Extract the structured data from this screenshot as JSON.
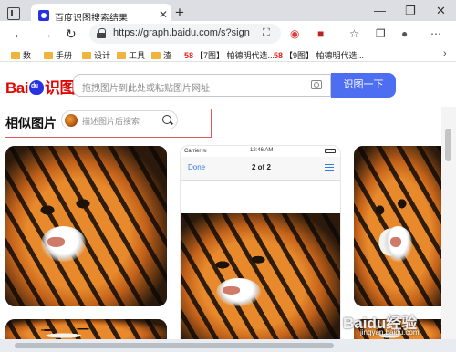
{
  "browser": {
    "tab_title": "百度识图搜索结果",
    "tab_close": "✕",
    "new_tab": "+",
    "window_controls": [
      "—",
      "❐",
      "✕"
    ],
    "nav": {
      "back": "←",
      "forward": "→",
      "refresh": "↻"
    },
    "url": "https://graph.baidu.com/s?sign...",
    "bookmarks": [
      {
        "label": "数",
        "folder": true
      },
      {
        "label": "手册",
        "folder": true
      },
      {
        "label": "设计",
        "folder": true
      },
      {
        "label": "工具",
        "folder": true
      },
      {
        "label": "渣",
        "folder": true
      },
      {
        "label": "【7图】 帕德明代选...",
        "folder": false,
        "badge": "58"
      },
      {
        "label": "【9图】 帕德明代选...",
        "folder": false,
        "badge": "58"
      }
    ],
    "bookmarks_more": "›"
  },
  "baidu": {
    "logo_left": "Bai",
    "logo_paw": "du",
    "logo_right": "识图",
    "search_placeholder": "拖拽图片到此处或粘贴图片网址",
    "search_button": "识图一下"
  },
  "similar": {
    "title": "相似图片",
    "search_placeholder": "描述图片后搜索"
  },
  "phone_preview": {
    "carrier": "Carrier ≋",
    "time": "12:46 AM",
    "done": "Done",
    "count": "2 of 2"
  },
  "watermark": {
    "brand": "Baidu经验",
    "url": "jingyan.baidu.com"
  },
  "colors": {
    "search_button": "#4e6ef2",
    "logo_red": "#e10602",
    "logo_blue": "#2932e1",
    "highlight_box": "#e05a5a"
  }
}
